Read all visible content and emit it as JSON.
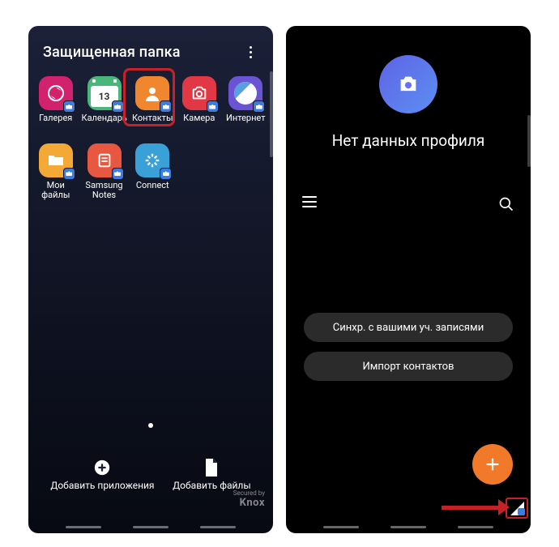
{
  "left": {
    "title": "Защищенная папка",
    "apps": {
      "gallery": "Галерея",
      "calendar": "Календарь",
      "calendar_day": "13",
      "contacts": "Контакты",
      "camera": "Камера",
      "internet": "Интернет",
      "myfiles": "Мои файлы",
      "samsungnotes": "Samsung Notes",
      "connect": "Connect"
    },
    "add_apps": "Добавить приложения",
    "add_files": "Добавить файлы",
    "knox_small": "Secured by",
    "knox_big": "Knox"
  },
  "right": {
    "profile_text": "Нет данных профиля",
    "sync_button": "Синхр. с вашими уч. записями",
    "import_button": "Импорт контактов"
  }
}
